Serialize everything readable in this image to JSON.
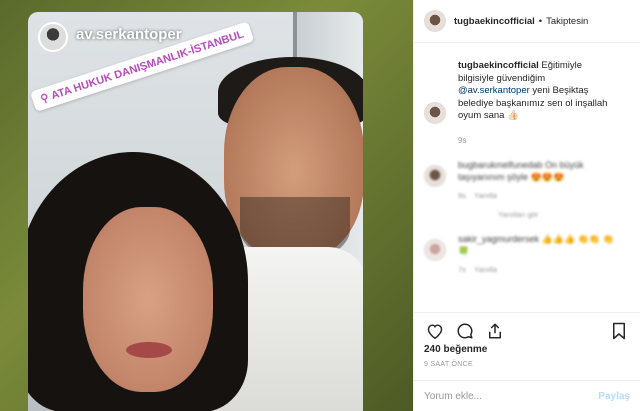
{
  "story": {
    "username": "av.serkantoper",
    "location": "ATA HUKUK DANIŞMANLIK-İSTANBUL"
  },
  "header": {
    "username": "tugbaekincofficial",
    "separator": "•",
    "follow_status": "Takiptesin"
  },
  "caption": {
    "username": "tugbaekincofficial",
    "text_before": "Eğitimiyle bilgisiyle güvendiğim",
    "mention": "@av.serkantoper",
    "text_after": "yeni Beşiktaş belediye başkanımız sen ol inşallah oyum sana 👍🏻",
    "time": "9s"
  },
  "comments": [
    {
      "username": "bugbarukmelfunedab",
      "text": "On büyük taşıyanınım şöyle 😍😍😍",
      "time": "9s",
      "reply": "Yanıtla"
    },
    {
      "username": "sakir_yagmurdersek",
      "text": "👍👍👍 👏👏 👏🍀",
      "time": "7s",
      "reply": "Yanıtla"
    }
  ],
  "view_replies": "Yanıtları gör",
  "actions": {
    "likes": "240 beğenme",
    "time_ago": "9 SAAT ÖNCE"
  },
  "add_comment": {
    "placeholder": "Yorum ekle...",
    "post_label": "Paylaş"
  },
  "colors": {
    "mention": "#003569",
    "location": "#b84bbf",
    "muted": "#999999"
  }
}
